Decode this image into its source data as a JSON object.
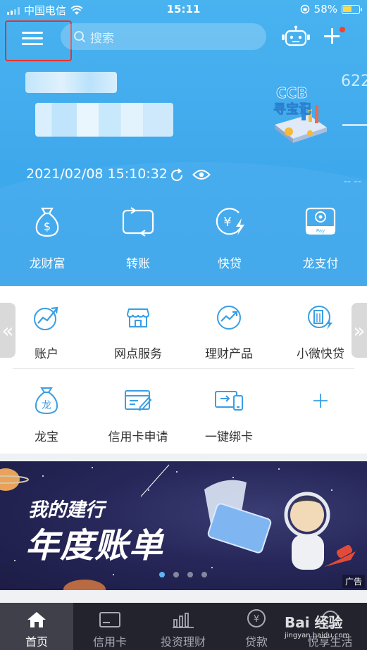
{
  "status_bar": {
    "carrier": "中国电信",
    "time": "15:11",
    "battery": "58%"
  },
  "header": {
    "search_placeholder": "搜索"
  },
  "account": {
    "number_prefix": "622",
    "datetime": "2021/02/08 15:10:32",
    "masked": "-- --"
  },
  "ccb_badge": {
    "line1": "CCB",
    "line2": "寻宝记"
  },
  "quick_actions": [
    {
      "label": "龙财富",
      "icon": "money-bag-icon"
    },
    {
      "label": "转账",
      "icon": "transfer-icon"
    },
    {
      "label": "快贷",
      "icon": "yen-lightning-icon"
    },
    {
      "label": "龙支付",
      "icon": "long-pay-icon"
    }
  ],
  "services": [
    {
      "label": "账户",
      "icon": "account-trend-icon"
    },
    {
      "label": "网点服务",
      "icon": "branch-store-icon"
    },
    {
      "label": "理财产品",
      "icon": "finance-chart-icon"
    },
    {
      "label": "小微快贷",
      "icon": "building-bolt-icon"
    },
    {
      "label": "龙宝",
      "icon": "dragon-bag-icon"
    },
    {
      "label": "信用卡申请",
      "icon": "card-apply-icon"
    },
    {
      "label": "一键绑卡",
      "icon": "card-bind-icon"
    }
  ],
  "banner": {
    "line1": "我的建行",
    "line2": "年度账单",
    "ad_tag": "广告",
    "active_dot": 0,
    "dot_count": 4
  },
  "tabs": [
    {
      "label": "首页",
      "icon": "home-icon",
      "active": true
    },
    {
      "label": "信用卡",
      "icon": "credit-card-icon",
      "active": false
    },
    {
      "label": "投资理财",
      "icon": "bar-chart-icon",
      "active": false
    },
    {
      "label": "贷款",
      "icon": "yen-circle-icon",
      "active": false
    },
    {
      "label": "悦享生活",
      "icon": "lifestyle-icon",
      "active": false
    }
  ],
  "watermark": {
    "text": "Bai 经验",
    "sub": "jingyan.baidu.com"
  },
  "colors": {
    "hero_blue": "#49b3f0",
    "icon_blue": "#3a9ee4",
    "tabbar": "#23232e",
    "highlight_red": "#e6322d"
  }
}
